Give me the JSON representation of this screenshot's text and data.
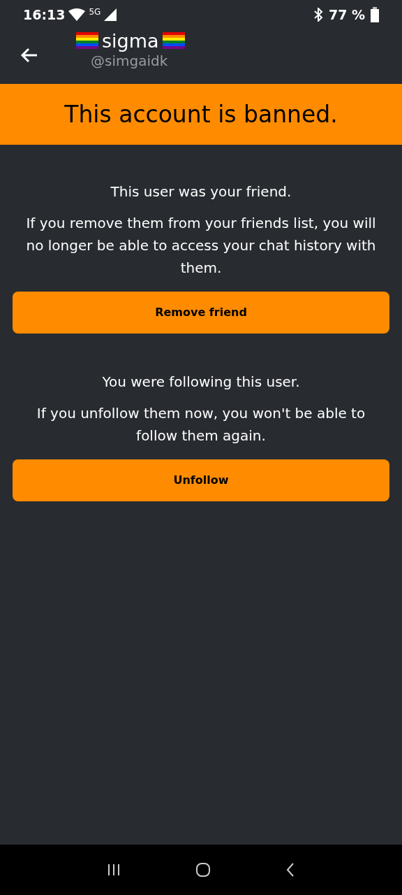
{
  "status_bar": {
    "time": "16:13",
    "network": "5G",
    "battery": "77 %"
  },
  "header": {
    "name": "sigma",
    "handle": "@simgaidk"
  },
  "banner": "This account is banned.",
  "sections": [
    {
      "title": "This user was your friend.",
      "body": "If you remove them from your friends list, you will no longer be able to access your chat history with them.",
      "button": "Remove friend"
    },
    {
      "title": "You were following this user.",
      "body": "If you unfollow them now, you won't be able to follow them again.",
      "button": "Unfollow"
    }
  ]
}
